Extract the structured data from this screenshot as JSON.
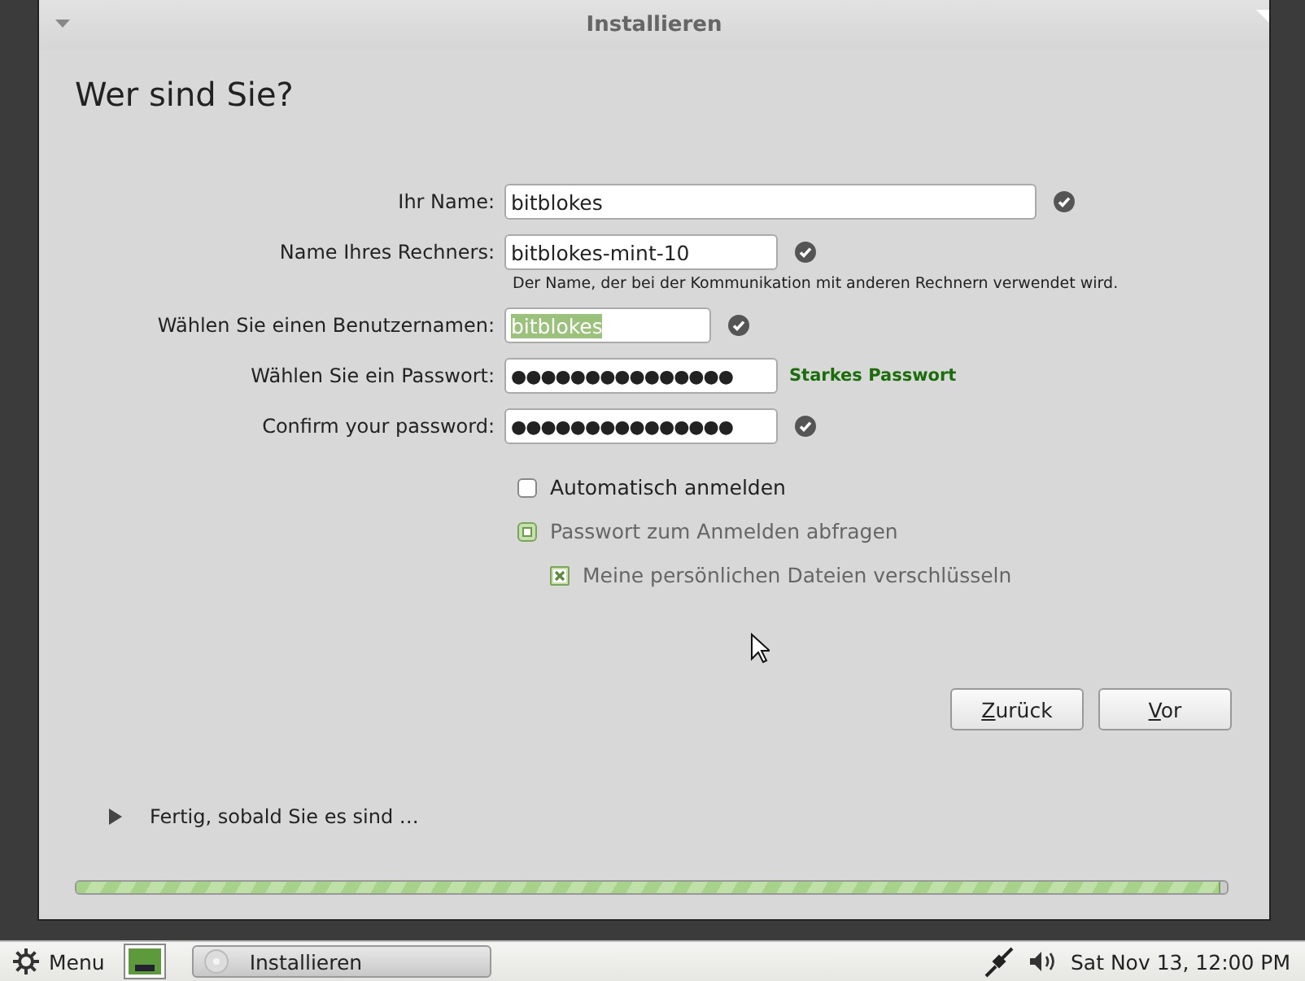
{
  "window": {
    "title": "Installieren"
  },
  "heading": "Wer sind Sie?",
  "fields": [
    {
      "label": "Ihr Name:",
      "value": "bitblokes",
      "valid": true,
      "selected": false
    },
    {
      "label": "Name Ihres Rechners:",
      "value": "bitblokes-mint-10",
      "valid": true,
      "selected": false,
      "hint": "Der Name, der bei der Kommunikation mit anderen Rechnern verwendet wird."
    },
    {
      "label": "Wählen Sie einen Benutzernamen:",
      "value": "bitblokes",
      "valid": true,
      "selected": true
    },
    {
      "label": "Wählen Sie ein Passwort:",
      "value": "●●●●●●●●●●●●●●●",
      "valid": false,
      "selected": false,
      "strength": "Starkes Passwort"
    },
    {
      "label": "Confirm your password:",
      "value": "●●●●●●●●●●●●●●●",
      "valid": true,
      "selected": false
    }
  ],
  "options": [
    {
      "kind": "option",
      "label": "Automatisch anmelden",
      "checked": false,
      "disabled": false
    },
    {
      "kind": "option",
      "label": "Passwort zum Anmelden abfragen",
      "checked": true,
      "disabled": true,
      "children": [
        {
          "kind": "checkbox",
          "label": "Meine persönlichen Dateien verschlüsseln",
          "checked": true,
          "disabled": true
        }
      ]
    }
  ],
  "buttons": [
    {
      "label": "Zurück"
    },
    {
      "label": "Vor"
    }
  ],
  "expander": {
    "label": "Fertig, sobald Sie es sind …",
    "expanded": false
  },
  "progress": {
    "level": 0.995
  },
  "taskbar": {
    "menu": "Menu",
    "tasks": [
      {
        "label": "Installieren"
      }
    ],
    "clock": "Sat Nov 13, 12:00 PM"
  }
}
